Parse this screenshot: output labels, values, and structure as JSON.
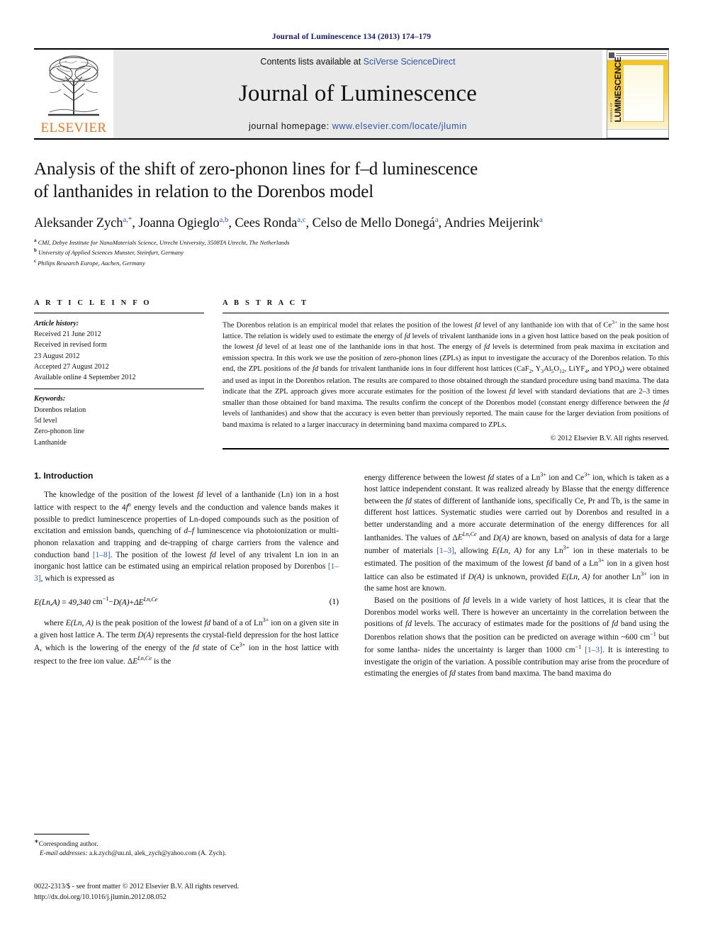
{
  "running_head": "Journal of Luminescence 134 (2013) 174–179",
  "masthead": {
    "contents_prefix": "Contents lists available at ",
    "contents_link": "SciVerse ScienceDirect",
    "journal_title": "Journal of Luminescence",
    "homepage_prefix": "journal homepage: ",
    "homepage_url": "www.elsevier.com/locate/jlumin",
    "publisher_wordmark": "ELSEVIER",
    "cover_title": "JOURNAL OF",
    "cover_title_main": "LUMINESCENCE"
  },
  "article": {
    "title_line1": "Analysis of the shift of zero-phonon lines for f–d luminescence",
    "title_line2": "of lanthanides in relation to the Dorenbos model",
    "authors_raw": "Aleksander Zych a,*, Joanna Ogieglo a,b, Cees Ronda a,c, Celso de Mello Donegá a, Andries Meijerink a",
    "affiliations": [
      "CMI, Debye Institute for NanoMaterials Science, Utrecht University, 3508TA Utrecht, The Netherlands",
      "University of Applied Sciences Munster, Steinfurt, Germany",
      "Philips Research Europe, Aachen, Germany"
    ]
  },
  "article_info": {
    "heading": "A R T I C L E   I N F O",
    "history_label": "Article history:",
    "history": [
      "Received 21 June 2012",
      "Received in revised form",
      "23 August 2012",
      "Accepted 27 August 2012",
      "Available online 4 September 2012"
    ],
    "keywords_label": "Keywords:",
    "keywords": [
      "Dorenbos relation",
      "5d level",
      "Zero-phonon line",
      "Lanthanide"
    ]
  },
  "abstract": {
    "heading": "A B S T R A C T",
    "text": "The Dorenbos relation is an empirical model that relates the position of the lowest fd level of any lanthanide ion with that of Ce3+ in the same host lattice. The relation is widely used to estimate the energy of fd levels of trivalent lanthanide ions in a given host lattice based on the peak position of the lowest fd level of at least one of the lanthanide ions in that host. The energy of fd levels is determined from peak maxima in excitation and emission spectra. In this work we use the position of zero-phonon lines (ZPLs) as input to investigate the accuracy of the Dorenbos relation. To this end, the ZPL positions of the fd bands for trivalent lanthanide ions in four different host lattices (CaF2, Y3Al5O12, LiYF4, and YPO4) were obtained and used as input in the Dorenbos relation. The results are compared to those obtained through the standard procedure using band maxima. The data indicate that the ZPL approach gives more accurate estimates for the position of the lowest fd level with standard deviations that are 2–3 times smaller than those obtained for band maxima. The results confirm the concept of the Dorenbos model (constant energy difference between the fd levels of lanthanides) and show that the accuracy is even better than previously reported. The main cause for the larger deviation from positions of band maxima is related to a larger inaccuracy in determining band maxima compared to ZPLs.",
    "copyright": "© 2012 Elsevier B.V. All rights reserved."
  },
  "introduction": {
    "heading": "1.  Introduction",
    "para1": "The knowledge of the position of the lowest fd level of a lanthanide (Ln) ion in a host lattice with respect to the 4fn energy levels and the conduction and valence bands makes it possible to predict luminescence properties of Ln-doped compounds such as the position of excitation and emission bands, quenching of d–f luminescence via photoionization or multi-phonon relaxation and trapping and de-trapping of charge carriers from the valence and conduction band [1–8]. The position of the lowest fd level of any trivalent Ln ion in an inorganic host lattice can be estimated using an empirical relation proposed by Dorenbos [1–3], which is expressed as",
    "equation": "E(Ln,A) = 49,340 cm−1 − D(A) + ΔELn,Ce",
    "equation_number": "(1)",
    "para2": "where E(Ln, A) is the peak position of the lowest fd band of a of Ln3+ ion on a given site in a given host lattice A. The term D(A) represents the crystal-field depression for the host lattice A, which is the lowering of the energy of the fd state of Ce3+ ion in the host lattice with respect to the free ion value. ΔELn,Ce is the",
    "para3": "energy difference between the lowest fd states of a Ln3+ ion and Ce3+ ion, which is taken as a host lattice independent constant. It was realized already by Blasse that the energy difference between the fd states of different of lanthanide ions, specifically Ce, Pr and Tb, is the same in different host lattices. Systematic studies were carried out by Dorenbos and resulted in a better understanding and a more accurate determination of the energy differences for all lanthanides. The values of ΔELn,Ce and D(A) are known, based on analysis of data for a large number of materials [1–3], allowing E(Ln, A) for any Ln3+ ion in these materials to be estimated. The position of the maximum of the lowest fd band of a Ln3+ ion in a given host lattice can also be estimated if D(A) is unknown, provided E(Ln, A) for another Ln3+ ion in the same host are known.",
    "para4": "Based on the positions of fd levels in a wide variety of host lattices, it is clear that the Dorenbos model works well. There is however an uncertainty in the correlation between the positions of fd levels. The accuracy of estimates made for the positions of fd band using the Dorenbos relation shows that the position can be predicted on average within ~600 cm−1 but for some lanthanides the uncertainty is larger than 1000 cm−1 [1–3]. It is interesting to investigate the origin of the variation. A possible contribution may arise from the procedure of estimating the energies of fd states from band maxima. The band maxima do"
  },
  "footnote": {
    "corresponding": "Corresponding author.",
    "email_label": "E-mail addresses:",
    "emails": "a.k.zych@uu.nl, alek_zych@yahoo.com (A. Zych)."
  },
  "footer": {
    "issn_line": "0022-2313/$ - see front matter © 2012 Elsevier B.V. All rights reserved.",
    "doi_line": "http://dx.doi.org/10.1016/j.jlumin.2012.08.052"
  },
  "colors": {
    "link_blue": "#2e57a4",
    "elsevier_orange": "#E87722",
    "runhead_blue": "#1a1a6e",
    "band_gray": "#e9e9e9"
  }
}
